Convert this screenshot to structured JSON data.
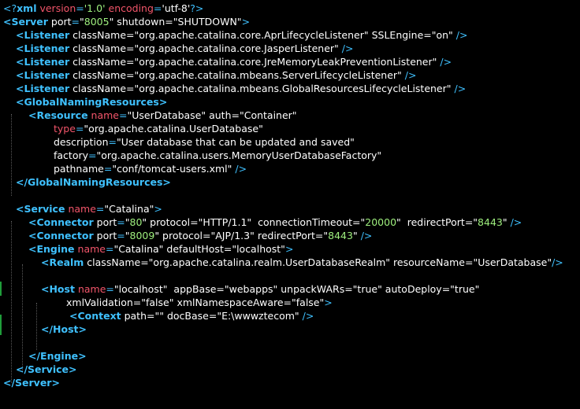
{
  "colors": {
    "background": "#000000",
    "tag": "#3fc1ff",
    "attribute": "#f2556a",
    "value": "#9ff07e",
    "text": "#ffffff",
    "gutter_change": "#1f9d3a"
  },
  "lines": [
    {
      "indent": 0,
      "segments": [
        [
          "punct",
          "<?"
        ],
        [
          "decl",
          "xml"
        ],
        [
          "white",
          " "
        ],
        [
          "attr",
          "version"
        ],
        [
          "punct",
          "="
        ],
        [
          "val",
          "'1.0'"
        ],
        [
          "white",
          " "
        ],
        [
          "attr",
          "encoding"
        ],
        [
          "punct",
          "="
        ],
        [
          "white",
          "'utf-8'"
        ],
        [
          "punct",
          "?>"
        ]
      ]
    },
    {
      "indent": 0,
      "segments": [
        [
          "tag",
          "<Server"
        ],
        [
          "white",
          " port"
        ],
        [
          "punct",
          "="
        ],
        [
          "white",
          "\""
        ],
        [
          "val",
          "8005"
        ],
        [
          "white",
          "\" shutdown=\"SHUTDOWN\""
        ],
        [
          "punct",
          ">"
        ]
      ]
    },
    {
      "indent": 1,
      "segments": [
        [
          "tag",
          "<Listener"
        ],
        [
          "white",
          " className=\"org.apache.catalina.core.AprLifecycleListener\" SSLEngine=\"on\" "
        ],
        [
          "punct",
          "/>"
        ]
      ]
    },
    {
      "indent": 1,
      "segments": [
        [
          "tag",
          "<Listener"
        ],
        [
          "white",
          " className=\"org.apache.catalina.core.JasperListener\" "
        ],
        [
          "punct",
          "/>"
        ]
      ]
    },
    {
      "indent": 1,
      "segments": [
        [
          "tag",
          "<Listener"
        ],
        [
          "white",
          " className=\"org.apache.catalina.core.JreMemoryLeakPreventionListener\" "
        ],
        [
          "punct",
          "/>"
        ]
      ]
    },
    {
      "indent": 1,
      "segments": [
        [
          "tag",
          "<Listener"
        ],
        [
          "white",
          " className=\"org.apache.catalina.mbeans.ServerLifecycleListener\" "
        ],
        [
          "punct",
          "/>"
        ]
      ]
    },
    {
      "indent": 1,
      "segments": [
        [
          "tag",
          "<Listener"
        ],
        [
          "white",
          " className=\"org.apache.catalina.mbeans.GlobalResourcesLifecycleListener\" "
        ],
        [
          "punct",
          "/>"
        ]
      ]
    },
    {
      "indent": 1,
      "segments": [
        [
          "tag",
          "<GlobalNamingResources>"
        ]
      ]
    },
    {
      "indent": 2,
      "segments": [
        [
          "tag",
          "<Resource"
        ],
        [
          "white",
          " "
        ],
        [
          "attr",
          "name"
        ],
        [
          "punct",
          "="
        ],
        [
          "white",
          "\"UserDatabase\" auth=\"Container\""
        ]
      ]
    },
    {
      "indent": 4,
      "segments": [
        [
          "attr",
          "type"
        ],
        [
          "punct",
          "="
        ],
        [
          "white",
          "\"org.apache.catalina.UserDatabase\""
        ]
      ]
    },
    {
      "indent": 4,
      "segments": [
        [
          "white",
          "description"
        ],
        [
          "punct",
          "="
        ],
        [
          "white",
          "\"User database that can be updated and saved\""
        ]
      ]
    },
    {
      "indent": 4,
      "segments": [
        [
          "white",
          "factory"
        ],
        [
          "punct",
          "="
        ],
        [
          "white",
          "\"org.apache.catalina.users.MemoryUserDatabaseFactory\""
        ]
      ]
    },
    {
      "indent": 4,
      "segments": [
        [
          "white",
          "pathname"
        ],
        [
          "punct",
          "="
        ],
        [
          "white",
          "\"conf/tomcat-users.xml\" "
        ],
        [
          "punct",
          "/>"
        ]
      ]
    },
    {
      "indent": 1,
      "segments": [
        [
          "tag",
          "</GlobalNamingResources>"
        ]
      ]
    },
    {
      "indent": 0,
      "segments": []
    },
    {
      "indent": 1,
      "segments": [
        [
          "tag",
          "<Service"
        ],
        [
          "white",
          " "
        ],
        [
          "attr",
          "name"
        ],
        [
          "punct",
          "="
        ],
        [
          "white",
          "\"Catalina\""
        ],
        [
          "punct",
          ">"
        ]
      ]
    },
    {
      "indent": 2,
      "segments": [
        [
          "tag",
          "<Connector"
        ],
        [
          "white",
          " port"
        ],
        [
          "punct",
          "="
        ],
        [
          "white",
          "\""
        ],
        [
          "val",
          "80"
        ],
        [
          "white",
          "\" protocol=\"HTTP/1.1\"  connectionTimeout=\""
        ],
        [
          "val",
          "20000"
        ],
        [
          "white",
          "\"  redirectPort=\""
        ],
        [
          "val",
          "8443"
        ],
        [
          "white",
          "\" "
        ],
        [
          "punct",
          "/>"
        ]
      ]
    },
    {
      "indent": 2,
      "segments": [
        [
          "tag",
          "<Connector"
        ],
        [
          "white",
          " port"
        ],
        [
          "punct",
          "="
        ],
        [
          "white",
          "\""
        ],
        [
          "val",
          "8009"
        ],
        [
          "white",
          "\" protocol=\"AJP/1.3\" redirectPort=\""
        ],
        [
          "val",
          "8443"
        ],
        [
          "white",
          "\" "
        ],
        [
          "punct",
          "/>"
        ]
      ]
    },
    {
      "indent": 2,
      "segments": [
        [
          "tag",
          "<Engine"
        ],
        [
          "white",
          " "
        ],
        [
          "attr",
          "name"
        ],
        [
          "punct",
          "="
        ],
        [
          "white",
          "\"Catalina\" defaultHost=\"localhost\""
        ],
        [
          "punct",
          ">"
        ]
      ]
    },
    {
      "indent": 3,
      "segments": [
        [
          "tag",
          "<Realm"
        ],
        [
          "white",
          " className=\"org.apache.catalina.realm.UserDatabaseRealm\" resourceName=\"UserDatabase\""
        ],
        [
          "punct",
          "/>"
        ]
      ]
    },
    {
      "indent": 0,
      "segments": []
    },
    {
      "indent": 3,
      "segments": [
        [
          "tag",
          "<Host"
        ],
        [
          "white",
          " "
        ],
        [
          "attr",
          "name"
        ],
        [
          "punct",
          "="
        ],
        [
          "white",
          "\"localhost\"  appBase=\"webapps\" unpackWARs=\"true\" autoDeploy=\"true\""
        ]
      ]
    },
    {
      "indent": 5,
      "segments": [
        [
          "white",
          "xmlValidation=\"false\" xmlNamespaceAware=\"false\""
        ],
        [
          "punct",
          ">"
        ]
      ]
    },
    {
      "indent": 5,
      "segments": [
        [
          "white",
          " "
        ],
        [
          "tag",
          "<Context"
        ],
        [
          "white",
          " path=\"\" docBase=\"E:\\wwwztecom\" "
        ],
        [
          "punct",
          "/>"
        ]
      ]
    },
    {
      "indent": 3,
      "segments": [
        [
          "tag",
          "</Host>"
        ]
      ]
    },
    {
      "indent": 0,
      "segments": []
    },
    {
      "indent": 2,
      "segments": [
        [
          "tag",
          "</Engine>"
        ]
      ]
    },
    {
      "indent": 1,
      "segments": [
        [
          "tag",
          "</Service>"
        ]
      ]
    },
    {
      "indent": 0,
      "segments": [
        [
          "tag",
          "</Server>"
        ]
      ]
    }
  ]
}
